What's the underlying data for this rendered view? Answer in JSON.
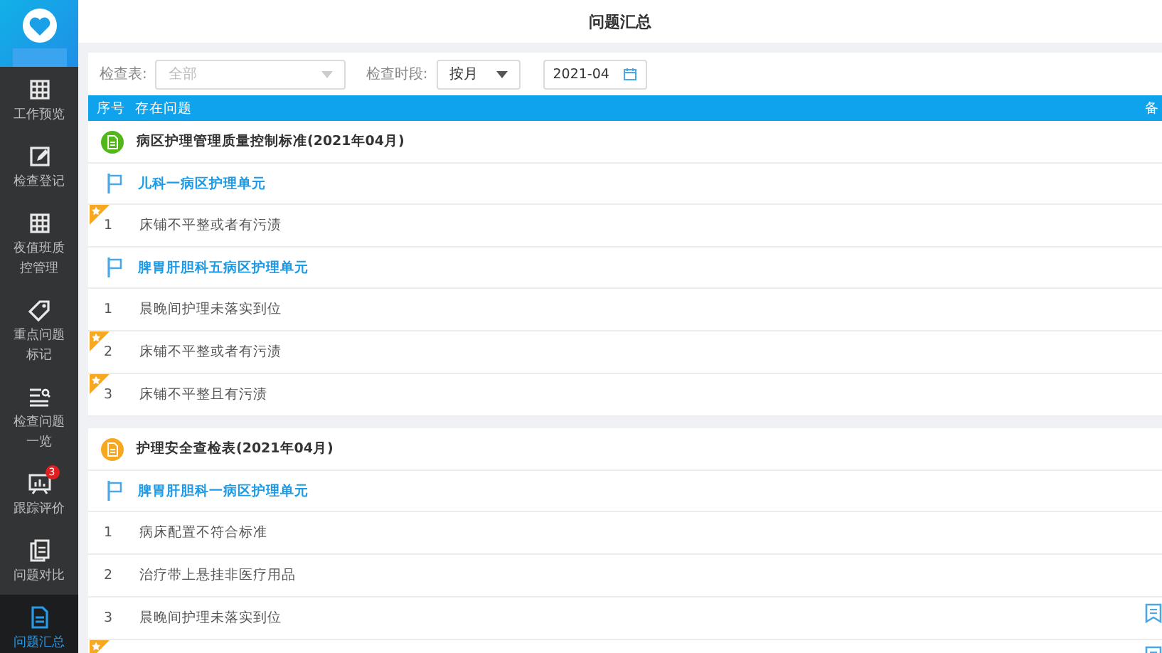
{
  "sidebar": {
    "items": [
      {
        "label": "工作预览",
        "selected": false
      },
      {
        "label": "检查登记",
        "selected": false
      },
      {
        "label": "夜值班质控管理",
        "selected": false
      },
      {
        "label": "重点问题标记",
        "selected": false
      },
      {
        "label": "检查问题一览",
        "selected": false
      },
      {
        "label": "跟踪评价",
        "selected": false,
        "badge": "3"
      },
      {
        "label": "问题对比",
        "selected": false
      },
      {
        "label": "问题汇总",
        "selected": true
      }
    ]
  },
  "title": "问题汇总",
  "filters": [
    {
      "label": "检查表:",
      "value": "全部",
      "kind": "select",
      "disabled": true
    },
    {
      "label": "检查时段:",
      "value": "按月",
      "kind": "select",
      "disabled": false
    },
    {
      "value": "2021-04",
      "kind": "date"
    }
  ],
  "table": {
    "columns": [
      "序号",
      "存在问题",
      "备"
    ],
    "groups": [
      {
        "title": "病区护理管理质量控制标准(2021年04月)",
        "color": "#52b81a",
        "units": [
          {
            "name": "儿科一病区护理单元",
            "items": [
              {
                "no": "1",
                "text": "床铺不平整或者有污渍",
                "starred": true,
                "note": false
              }
            ]
          },
          {
            "name": "脾胃肝胆科五病区护理单元",
            "items": [
              {
                "no": "1",
                "text": "晨晚间护理未落实到位",
                "starred": false,
                "note": false
              },
              {
                "no": "2",
                "text": "床铺不平整或者有污渍",
                "starred": true,
                "note": false
              },
              {
                "no": "3",
                "text": "床铺不平整且有污渍",
                "starred": true,
                "note": false
              }
            ]
          }
        ]
      },
      {
        "title": "护理安全查检表(2021年04月)",
        "color": "#f7a823",
        "units": [
          {
            "name": "脾胃肝胆科一病区护理单元",
            "items": [
              {
                "no": "1",
                "text": "病床配置不符合标准",
                "starred": false,
                "note": false
              },
              {
                "no": "2",
                "text": "治疗带上悬挂非医疗用品",
                "starred": false,
                "note": false
              },
              {
                "no": "3",
                "text": "晨晚间护理未落实到位",
                "starred": false,
                "note": true
              },
              {
                "starred": true,
                "note": true
              }
            ]
          }
        ]
      }
    ]
  }
}
